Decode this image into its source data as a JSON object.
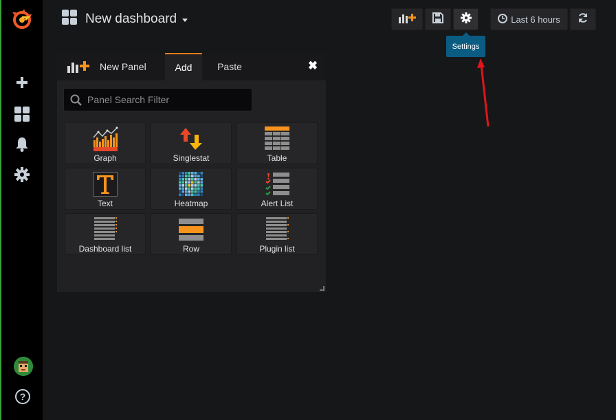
{
  "topbar": {
    "dashboard_title": "New dashboard",
    "time_range_label": "Last 6 hours",
    "settings_tooltip": "Settings"
  },
  "colors": {
    "accent_orange": "#eb7b18",
    "tooltip_blue": "#0b5c82",
    "annotation_arrow": "#e0141b"
  },
  "sidemenu": {
    "items": [
      "grafana-logo-icon",
      "plus-icon",
      "dashboards-icon",
      "bell-icon",
      "gear-icon"
    ],
    "help_label": "?"
  },
  "panel": {
    "header_title": "New Panel",
    "tabs": [
      {
        "label": "Add",
        "active": true
      },
      {
        "label": "Paste",
        "active": false
      }
    ],
    "search_placeholder": "Panel Search Filter",
    "cards": [
      {
        "label": "Graph",
        "icon": "graph-icon"
      },
      {
        "label": "Singlestat",
        "icon": "singlestat-icon"
      },
      {
        "label": "Table",
        "icon": "table-icon"
      },
      {
        "label": "Text",
        "icon": "text-icon"
      },
      {
        "label": "Heatmap",
        "icon": "heatmap-icon"
      },
      {
        "label": "Alert List",
        "icon": "alert-list-icon"
      },
      {
        "label": "Dashboard list",
        "icon": "dashboard-list-icon"
      },
      {
        "label": "Row",
        "icon": "row-icon"
      },
      {
        "label": "Plugin list",
        "icon": "plugin-list-icon"
      }
    ]
  }
}
